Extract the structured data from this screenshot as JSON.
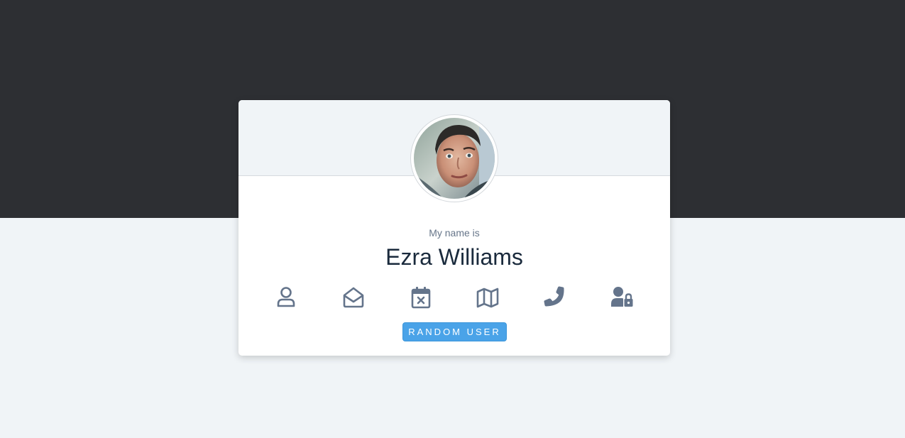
{
  "profile": {
    "label": "My name is",
    "name": "Ezra Williams"
  },
  "icons": [
    "user-icon",
    "envelope-open-icon",
    "calendar-x-icon",
    "map-icon",
    "phone-icon",
    "user-lock-icon"
  ],
  "button": {
    "label": "RANDOM USER"
  },
  "colors": {
    "top_band": "#2d2f33",
    "page_background": "#f0f4f7",
    "icon": "#64748b",
    "accent": "#4aa3e8",
    "name_text": "#1a2a3c"
  }
}
